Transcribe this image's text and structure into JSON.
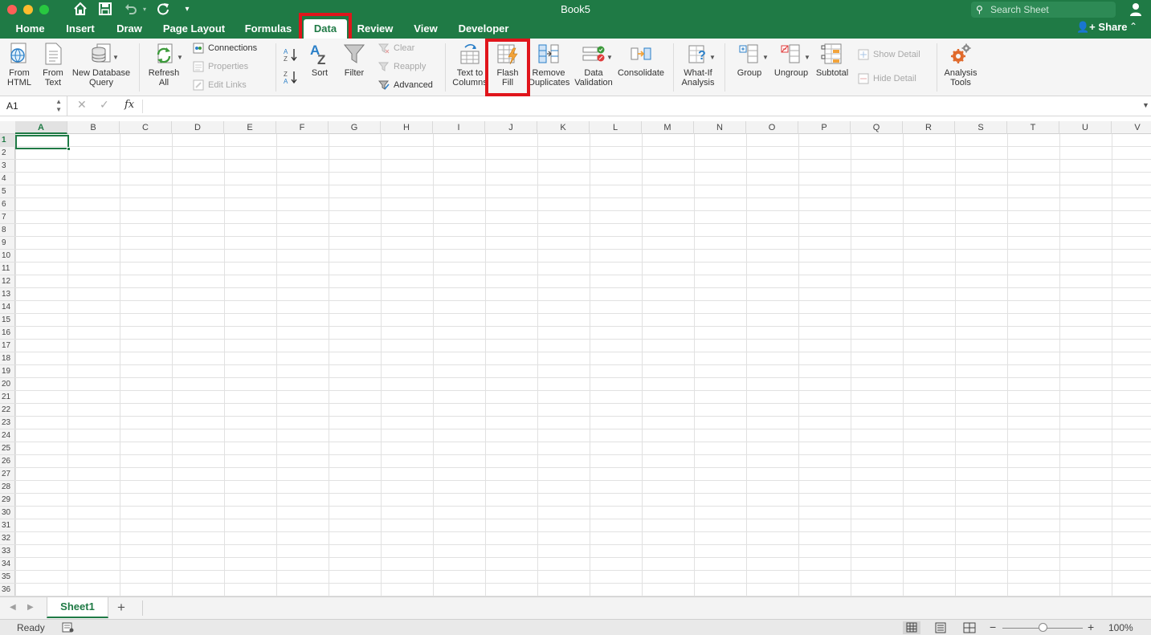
{
  "title_bar": {
    "document_title": "Book5",
    "search_placeholder": "Search Sheet"
  },
  "tabs": [
    {
      "label": "Home"
    },
    {
      "label": "Insert"
    },
    {
      "label": "Draw"
    },
    {
      "label": "Page Layout"
    },
    {
      "label": "Formulas"
    },
    {
      "label": "Data",
      "active": true
    },
    {
      "label": "Review"
    },
    {
      "label": "View"
    },
    {
      "label": "Developer"
    }
  ],
  "share_label": "Share",
  "ribbon": {
    "from_html": "From\nHTML",
    "from_text": "From\nText",
    "new_db_query": "New Database\nQuery",
    "refresh_all": "Refresh\nAll",
    "connections": "Connections",
    "properties": "Properties",
    "edit_links": "Edit Links",
    "sort": "Sort",
    "filter": "Filter",
    "clear": "Clear",
    "reapply": "Reapply",
    "advanced": "Advanced",
    "text_to_columns": "Text to\nColumns",
    "flash_fill": "Flash\nFill",
    "remove_duplicates": "Remove\nDuplicates",
    "data_validation": "Data\nValidation",
    "consolidate": "Consolidate",
    "what_if": "What-If\nAnalysis",
    "group": "Group",
    "ungroup": "Ungroup",
    "subtotal": "Subtotal",
    "show_detail": "Show Detail",
    "hide_detail": "Hide Detail",
    "analysis_tools": "Analysis\nTools"
  },
  "formula_bar": {
    "name_box": "A1",
    "fx_label": "fx",
    "formula": ""
  },
  "columns": [
    "A",
    "B",
    "C",
    "D",
    "E",
    "F",
    "G",
    "H",
    "I",
    "J",
    "K",
    "L",
    "M",
    "N",
    "O",
    "P",
    "Q",
    "R",
    "S",
    "T",
    "U",
    "V"
  ],
  "rows": [
    "1",
    "2",
    "3",
    "4",
    "5",
    "6",
    "7",
    "8",
    "9",
    "10",
    "11",
    "12",
    "13",
    "14",
    "15",
    "16",
    "17",
    "18",
    "19",
    "20",
    "21",
    "22",
    "23",
    "24",
    "25",
    "26",
    "27",
    "28",
    "29",
    "30",
    "31",
    "32",
    "33",
    "34",
    "35",
    "36"
  ],
  "selected_cell": "A1",
  "sheets": [
    {
      "name": "Sheet1",
      "active": true
    }
  ],
  "add_sheet_label": "+",
  "status": {
    "ready": "Ready",
    "zoom": "100%",
    "zoom_value": 100
  },
  "colors": {
    "accent": "#1f7a45",
    "highlight": "#e0151b"
  }
}
